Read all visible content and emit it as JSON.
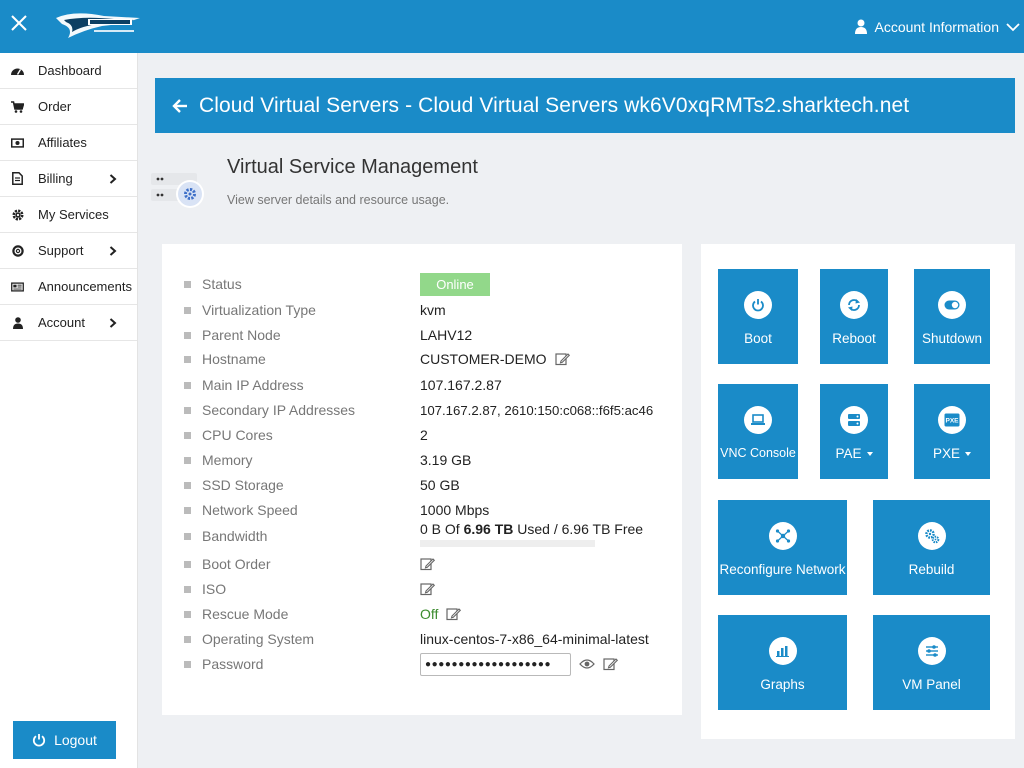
{
  "header": {
    "account_label": "Account Information"
  },
  "sidebar": {
    "items": [
      {
        "label": "Dashboard"
      },
      {
        "label": "Order"
      },
      {
        "label": "Affiliates"
      },
      {
        "label": "Billing"
      },
      {
        "label": "My Services"
      },
      {
        "label": "Support"
      },
      {
        "label": "Announcements"
      },
      {
        "label": "Account"
      }
    ],
    "logout_label": "Logout"
  },
  "banner": {
    "title": "Cloud Virtual Servers - Cloud Virtual Servers wk6V0xqRMTs2.sharktech.net"
  },
  "section": {
    "title": "Virtual Service Management",
    "subtitle": "View server details and resource usage."
  },
  "details": {
    "status": {
      "label": "Status",
      "value": "Online"
    },
    "virtualization": {
      "label": "Virtualization Type",
      "value": "kvm"
    },
    "parent_node": {
      "label": "Parent Node",
      "value": "LAHV12"
    },
    "hostname": {
      "label": "Hostname",
      "value": "CUSTOMER-DEMO"
    },
    "main_ip": {
      "label": "Main IP Address",
      "value": "107.167.2.87"
    },
    "secondary_ip": {
      "label": "Secondary IP Addresses",
      "value": "107.167.2.87, 2610:150:c068::f6f5:ac46"
    },
    "cpu": {
      "label": "CPU Cores",
      "value": "2"
    },
    "memory": {
      "label": "Memory",
      "value": "3.19 GB"
    },
    "storage": {
      "label": "SSD Storage",
      "value": "50 GB"
    },
    "network": {
      "label": "Network Speed",
      "value": "1000 Mbps"
    },
    "bandwidth": {
      "label": "Bandwidth",
      "prefix": "0 B Of",
      "total_bold": "6.96 TB",
      "suffix": "Used / 6.96 TB Free",
      "used_fraction": 0
    },
    "boot_order": {
      "label": "Boot Order"
    },
    "iso": {
      "label": "ISO"
    },
    "rescue": {
      "label": "Rescue Mode",
      "value": "Off"
    },
    "os": {
      "label": "Operating System",
      "value": "linux-centos-7-x86_64-minimal-latest"
    },
    "password": {
      "label": "Password",
      "value": "●●●●●●●●●●●●●●●●●●●"
    }
  },
  "actions": {
    "boot": "Boot",
    "reboot": "Reboot",
    "shutdown": "Shutdown",
    "vnc": "VNC Console",
    "pae": "PAE",
    "pxe": "PXE",
    "reconfigure": "Reconfigure Network",
    "rebuild": "Rebuild",
    "graphs": "Graphs",
    "vmpanel": "VM Panel",
    "pxe_icon_text": "PXE"
  },
  "colors": {
    "primary": "#1a8bc8",
    "online": "#92d88a",
    "off": "#3c8c2e"
  }
}
